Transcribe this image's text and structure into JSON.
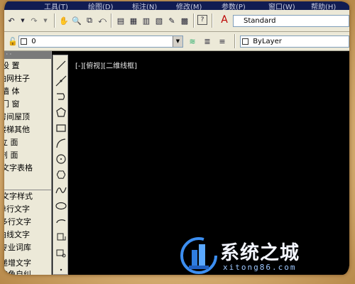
{
  "menubar": {
    "items": [
      "工具(T)",
      "绘图(D)",
      "标注(N)",
      "修改(M)",
      "参数(P)",
      "窗口(W)",
      "帮助(H)"
    ]
  },
  "toolbar": {
    "text_style": "Standard",
    "layer_value": "0",
    "color_value": "ByLayer"
  },
  "palette": {
    "items": [
      {
        "label": "设      置"
      },
      {
        "label": "轴网柱子"
      },
      {
        "label": "墙      体"
      },
      {
        "label": "门      窗"
      },
      {
        "label": "房间屋顶"
      },
      {
        "label": "楼梯其他"
      },
      {
        "label": "立      面"
      },
      {
        "label": "剖      面"
      },
      {
        "label": "文字表格"
      },
      {
        "label": "文字样式"
      },
      {
        "label": "单行文字"
      },
      {
        "label": "多行文字"
      },
      {
        "label": "曲线文字"
      },
      {
        "label": "专业词库"
      },
      {
        "label": "递增文字"
      },
      {
        "label": "转角自纠"
      }
    ]
  },
  "canvas": {
    "viewport_label": "[-][俯视][二维线框]",
    "background": "#000000"
  },
  "watermark": {
    "title": "系统之城",
    "url": "xitong86.com"
  },
  "colors": {
    "menubar": "#111c52",
    "toolbar": "#ece9d8",
    "frame": "#e3c48a"
  }
}
